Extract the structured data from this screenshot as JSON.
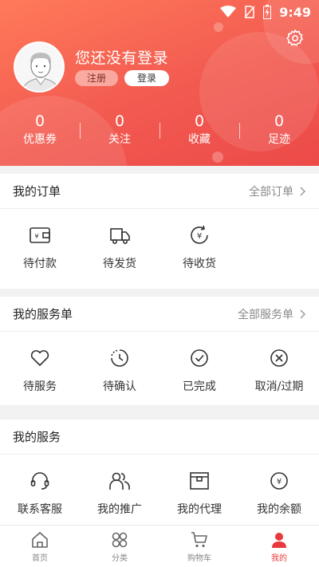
{
  "status": {
    "time": "9:49"
  },
  "profile": {
    "title": "您还没有登录",
    "register_label": "注册",
    "login_label": "登录"
  },
  "stats": [
    {
      "value": "0",
      "label": "优惠券"
    },
    {
      "value": "0",
      "label": "关注"
    },
    {
      "value": "0",
      "label": "收藏"
    },
    {
      "value": "0",
      "label": "足迹"
    }
  ],
  "orders": {
    "title": "我的订单",
    "more": "全部订单",
    "items": [
      {
        "label": "待付款",
        "icon": "wallet-icon"
      },
      {
        "label": "待发货",
        "icon": "truck-icon"
      },
      {
        "label": "待收货",
        "icon": "yuan-refresh-icon"
      }
    ]
  },
  "service_orders": {
    "title": "我的服务单",
    "more": "全部服务单",
    "items": [
      {
        "label": "待服务",
        "icon": "heart-icon"
      },
      {
        "label": "待确认",
        "icon": "clock-icon"
      },
      {
        "label": "已完成",
        "icon": "check-circle-icon"
      },
      {
        "label": "取消/过期",
        "icon": "x-circle-icon"
      }
    ]
  },
  "services": {
    "title": "我的服务",
    "items": [
      {
        "label": "联系客服",
        "icon": "headset-icon"
      },
      {
        "label": "我的推广",
        "icon": "users-icon"
      },
      {
        "label": "我的代理",
        "icon": "box-icon"
      },
      {
        "label": "我的余额",
        "icon": "yuan-coin-icon"
      }
    ]
  },
  "tabbar": [
    {
      "label": "首页",
      "icon": "home-icon"
    },
    {
      "label": "分类",
      "icon": "category-icon"
    },
    {
      "label": "购物车",
      "icon": "cart-icon"
    },
    {
      "label": "我的",
      "icon": "user-icon"
    }
  ],
  "colors": {
    "brand": "#e8393c",
    "header_start": "#ff7a5a",
    "header_end": "#ec4a48"
  }
}
